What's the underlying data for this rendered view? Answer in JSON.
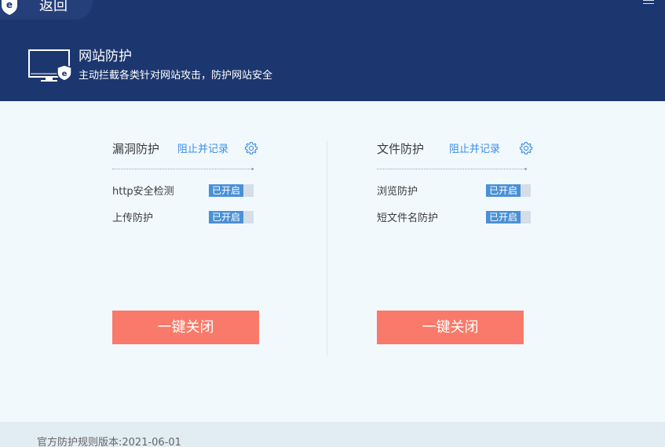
{
  "header": {
    "back_label": "返回",
    "title": "网站防护",
    "description": "主动拦截各类针对网站攻击，防护网站安全",
    "badge_letter": "e"
  },
  "panels": [
    {
      "title": "漏洞防护",
      "action_link": "阻止并记录",
      "items": [
        {
          "label": "http安全检测",
          "status": "已开启"
        },
        {
          "label": "上传防护",
          "status": "已开启"
        }
      ],
      "close_button": "一键关闭"
    },
    {
      "title": "文件防护",
      "action_link": "阻止并记录",
      "items": [
        {
          "label": "浏览防护",
          "status": "已开启"
        },
        {
          "label": "短文件名防护",
          "status": "已开启"
        }
      ],
      "close_button": "一键关闭"
    }
  ],
  "footer": {
    "rules_version": "官方防护规则版本:2021-06-01"
  },
  "colors": {
    "header_bg": "#1c376f",
    "body_bg": "#f2f9fd",
    "link": "#3a8ee6",
    "toggle_on": "#4a90d6",
    "close_button": "#f97a6a"
  },
  "icons": {
    "back": "shield-e-icon",
    "menu": "hamburger-menu-icon",
    "monitor": "monitor-shield-icon",
    "settings": "gear-icon"
  }
}
